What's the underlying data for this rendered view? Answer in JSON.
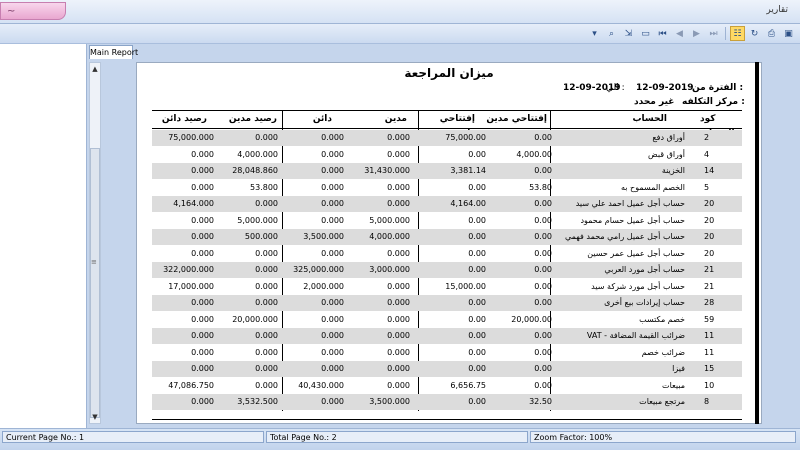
{
  "window": {
    "title": "تقارير",
    "title_tab_label": "~"
  },
  "toolbar": {
    "buttons": [
      "tree",
      "find",
      "export",
      "page-setup",
      "first",
      "prev",
      "next",
      "last",
      "toggle-group",
      "refresh",
      "print",
      "save"
    ]
  },
  "report_tab": {
    "label": "Main Report"
  },
  "report": {
    "title": "ميزان المراجعة",
    "period_label": "الفترة من :",
    "period_from": "12-09-2019",
    "period_to_label": "الي :",
    "period_to": "12-09-2019",
    "cost_center_label": "مركز التكلفه :",
    "cost_center_value": "غير محدد",
    "columns": {
      "code": "كود الحساب",
      "account": "الحساب",
      "opening_debit": "إفتتاحي مدين",
      "opening_credit": "إفتتاحي دائن",
      "debit": "مدين",
      "credit": "دائن",
      "balance_debit": "رصيد مدين",
      "balance_credit": "رصيد دائن"
    },
    "rows": [
      {
        "code": "2",
        "account": "أوراق دفع",
        "opening_debit": "0.00",
        "opening_credit": "75,000.00",
        "debit": "0.000",
        "credit": "0.000",
        "balance_debit": "0.000",
        "balance_credit": "75,000.000"
      },
      {
        "code": "4",
        "account": "أوراق قبض",
        "opening_debit": "4,000.00",
        "opening_credit": "0.00",
        "debit": "0.000",
        "credit": "0.000",
        "balance_debit": "4,000.000",
        "balance_credit": "0.000"
      },
      {
        "code": "14",
        "account": "الخزينة",
        "opening_debit": "0.00",
        "opening_credit": "3,381.14",
        "debit": "31,430.000",
        "credit": "0.000",
        "balance_debit": "28,048.860",
        "balance_credit": "0.000"
      },
      {
        "code": "5",
        "account": "الخصم المسموح به",
        "opening_debit": "53.80",
        "opening_credit": "0.00",
        "debit": "0.000",
        "credit": "0.000",
        "balance_debit": "53.800",
        "balance_credit": "0.000"
      },
      {
        "code": "20",
        "account": "حساب أجل عميل احمد علي سيد",
        "opening_debit": "0.00",
        "opening_credit": "4,164.00",
        "debit": "0.000",
        "credit": "0.000",
        "balance_debit": "0.000",
        "balance_credit": "4,164.000"
      },
      {
        "code": "20",
        "account": "حساب أجل عميل حسام محمود",
        "opening_debit": "0.00",
        "opening_credit": "0.00",
        "debit": "5,000.000",
        "credit": "0.000",
        "balance_debit": "5,000.000",
        "balance_credit": "0.000"
      },
      {
        "code": "20",
        "account": "حساب أجل عميل رامي محمد فهمي",
        "opening_debit": "0.00",
        "opening_credit": "0.00",
        "debit": "4,000.000",
        "credit": "3,500.000",
        "balance_debit": "500.000",
        "balance_credit": "0.000"
      },
      {
        "code": "20",
        "account": "حساب أجل عميل عمر حسين",
        "opening_debit": "0.00",
        "opening_credit": "0.00",
        "debit": "0.000",
        "credit": "0.000",
        "balance_debit": "0.000",
        "balance_credit": "0.000"
      },
      {
        "code": "21",
        "account": "حساب أجل مورد العربي",
        "opening_debit": "0.00",
        "opening_credit": "0.00",
        "debit": "3,000.000",
        "credit": "325,000.000",
        "balance_debit": "0.000",
        "balance_credit": "322,000.000"
      },
      {
        "code": "21",
        "account": "حساب أجل مورد شركة سيد",
        "opening_debit": "0.00",
        "opening_credit": "15,000.00",
        "debit": "0.000",
        "credit": "2,000.000",
        "balance_debit": "0.000",
        "balance_credit": "17,000.000"
      },
      {
        "code": "28",
        "account": "حساب إيرادات بيع أخرى",
        "opening_debit": "0.00",
        "opening_credit": "0.00",
        "debit": "0.000",
        "credit": "0.000",
        "balance_debit": "0.000",
        "balance_credit": "0.000"
      },
      {
        "code": "59",
        "account": "خصم مكتسب",
        "opening_debit": "20,000.00",
        "opening_credit": "0.00",
        "debit": "0.000",
        "credit": "0.000",
        "balance_debit": "20,000.000",
        "balance_credit": "0.000"
      },
      {
        "code": "11",
        "account": "VAT - ضرائب القيمة المضافة",
        "opening_debit": "0.00",
        "opening_credit": "0.00",
        "debit": "0.000",
        "credit": "0.000",
        "balance_debit": "0.000",
        "balance_credit": "0.000"
      },
      {
        "code": "11",
        "account": "ضرائب خصم",
        "opening_debit": "0.00",
        "opening_credit": "0.00",
        "debit": "0.000",
        "credit": "0.000",
        "balance_debit": "0.000",
        "balance_credit": "0.000"
      },
      {
        "code": "15",
        "account": "فيزا",
        "opening_debit": "0.00",
        "opening_credit": "0.00",
        "debit": "0.000",
        "credit": "0.000",
        "balance_debit": "0.000",
        "balance_credit": "0.000"
      },
      {
        "code": "10",
        "account": "مبيعات",
        "opening_debit": "0.00",
        "opening_credit": "6,656.75",
        "debit": "0.000",
        "credit": "40,430.000",
        "balance_debit": "0.000",
        "balance_credit": "47,086.750"
      },
      {
        "code": "8",
        "account": "مرتجع مبيعات",
        "opening_debit": "32.50",
        "opening_credit": "0.00",
        "debit": "3,500.000",
        "credit": "0.000",
        "balance_debit": "3,532.500",
        "balance_credit": "0.000"
      }
    ]
  },
  "status": {
    "current_page": "Current Page No.: 1",
    "total_page": "Total Page No.: 2",
    "zoom": "Zoom Factor: 100%"
  }
}
